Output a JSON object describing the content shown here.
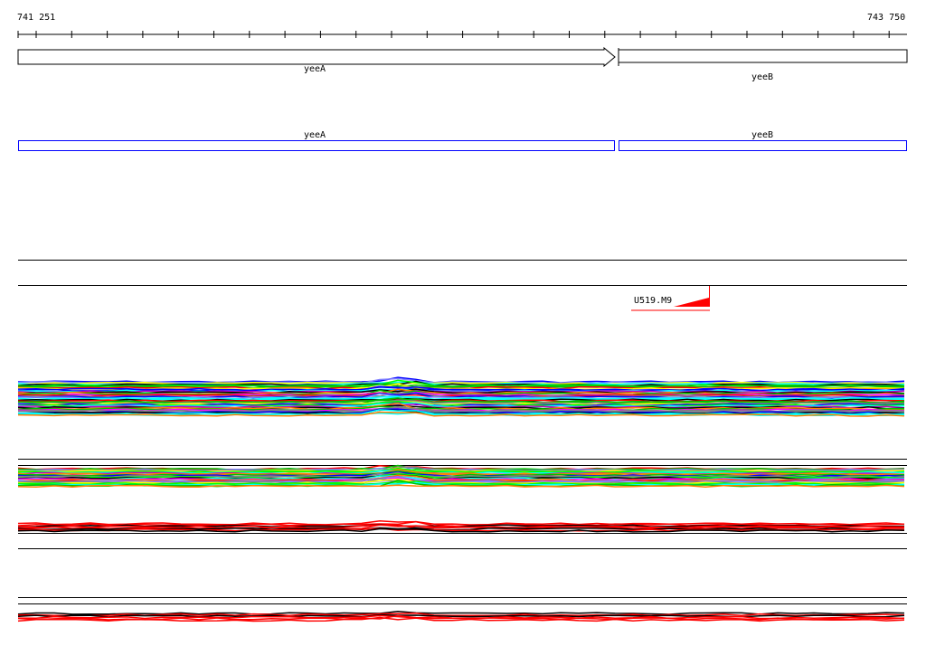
{
  "ruler": {
    "start_label": "741 251",
    "end_label": "743 750"
  },
  "genes": [
    {
      "name": "yeeA",
      "strand": "+"
    },
    {
      "name": "yeeB",
      "strand": "+"
    }
  ],
  "annotations": [
    {
      "name": "yeeA"
    },
    {
      "name": "yeeB"
    }
  ],
  "feature": {
    "label": "U519.M9",
    "color": "#ff0000"
  },
  "colors": {
    "annotation": "#0000ff",
    "feature": "#ff0000"
  }
}
